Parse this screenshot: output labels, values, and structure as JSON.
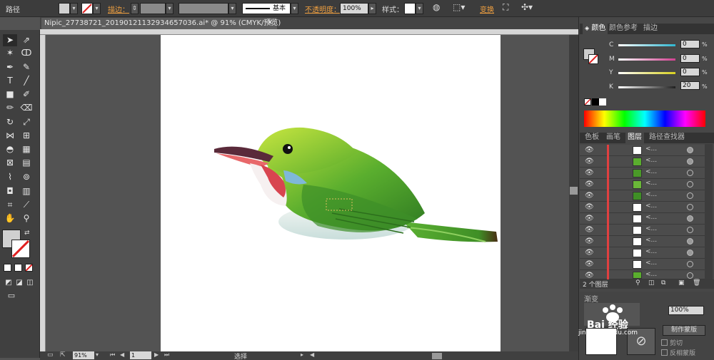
{
  "control_bar": {
    "selection_type": "路径",
    "stroke_label": "描边：",
    "stroke_style": "基本",
    "opacity_label": "不透明度：",
    "opacity_value": "100%",
    "style_label": "样式：",
    "transform_label": "变换"
  },
  "document": {
    "tab_title": "Nipic_27738721_20190121132934657036.ai* @ 91% (CMYK/预览)",
    "zoom": "91%",
    "artboard": "1",
    "status_text": "选择"
  },
  "color_panel": {
    "tabs": [
      "颜色",
      "颜色参考",
      "描边"
    ],
    "channels": [
      {
        "label": "C",
        "value": "0",
        "color": "#2fb6d0"
      },
      {
        "label": "M",
        "value": "0",
        "color": "#d04090"
      },
      {
        "label": "Y",
        "value": "0",
        "color": "#d8d020"
      },
      {
        "label": "K",
        "value": "20",
        "color": "#202020"
      }
    ],
    "unit": "%"
  },
  "layers_panel": {
    "tabs": [
      "色板",
      "画笔",
      "图层",
      "路径查找器"
    ],
    "rows": [
      {
        "name": "<...",
        "thumb": "white"
      },
      {
        "name": "<...",
        "thumb": "green"
      },
      {
        "name": "<...",
        "thumb": "green"
      },
      {
        "name": "<...",
        "thumb": "green"
      },
      {
        "name": "<...",
        "thumb": "green"
      },
      {
        "name": "<...",
        "thumb": "white"
      },
      {
        "name": "<...",
        "thumb": "white"
      },
      {
        "name": "<...",
        "thumb": "white"
      },
      {
        "name": "<...",
        "thumb": "white"
      },
      {
        "name": "<...",
        "thumb": "white"
      },
      {
        "name": "<...",
        "thumb": "white"
      },
      {
        "name": "<...",
        "thumb": "green"
      }
    ],
    "count": "2 个图层"
  },
  "transparency_panel": {
    "tab": "渐变",
    "opacity_value": "100%",
    "make_mask": "制作蒙版",
    "clip": "剪切",
    "invert_mask": "反相蒙版"
  },
  "watermark": {
    "text": "Bai 经验",
    "url": "jingyan.baidu.com"
  }
}
